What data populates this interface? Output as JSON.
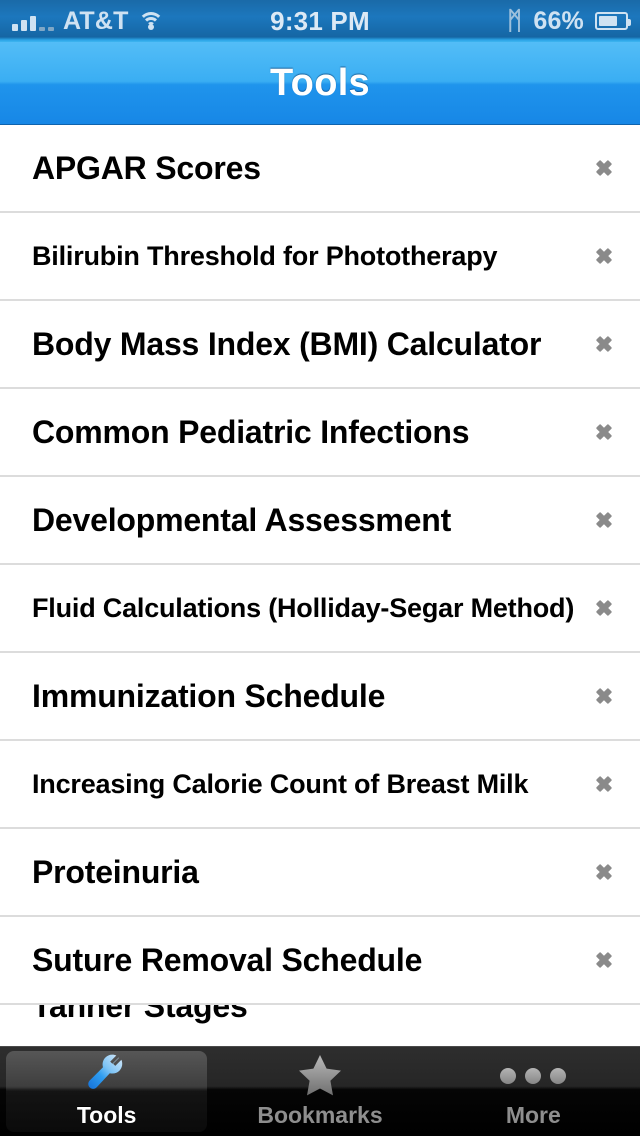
{
  "status_bar": {
    "carrier": "AT&T",
    "time": "9:31 PM",
    "battery_percent": "66%",
    "bluetooth_glyph": "ᛗ",
    "signal_bars_filled": 3,
    "signal_bars_empty": 2,
    "battery_level_fraction": 0.66,
    "tint": "#cfe2f2"
  },
  "nav": {
    "title": "Tools",
    "accent": "#3aaef3"
  },
  "list": {
    "rows": [
      {
        "label": "APGAR Scores",
        "size": "lg"
      },
      {
        "label": "Bilirubin Threshold for Phototherapy",
        "size": "sm"
      },
      {
        "label": "Body Mass Index (BMI) Calculator",
        "size": "lg"
      },
      {
        "label": "Common Pediatric Infections",
        "size": "lg"
      },
      {
        "label": "Developmental Assessment",
        "size": "lg"
      },
      {
        "label": "Fluid Calculations (Holliday-Segar Method)",
        "size": "sm"
      },
      {
        "label": "Immunization Schedule",
        "size": "lg"
      },
      {
        "label": "Increasing Calorie Count of Breast Milk",
        "size": "sm"
      },
      {
        "label": "Proteinuria",
        "size": "lg"
      },
      {
        "label": "Suture Removal Schedule",
        "size": "lg"
      },
      {
        "label": "Tanner Stages",
        "size": "lg",
        "clipped": true
      }
    ],
    "separator_color": "#dcdcdc",
    "text_color": "#000000",
    "chevron_color": "#8a8a8a"
  },
  "tabbar": {
    "tabs": [
      {
        "label": "Tools",
        "icon": "wrench-icon",
        "selected": true
      },
      {
        "label": "Bookmarks",
        "icon": "star-icon",
        "selected": false
      },
      {
        "label": "More",
        "icon": "ellipsis-icon",
        "selected": false
      }
    ],
    "selected_label_color": "#ffffff",
    "label_color": "#8e8e8e"
  }
}
